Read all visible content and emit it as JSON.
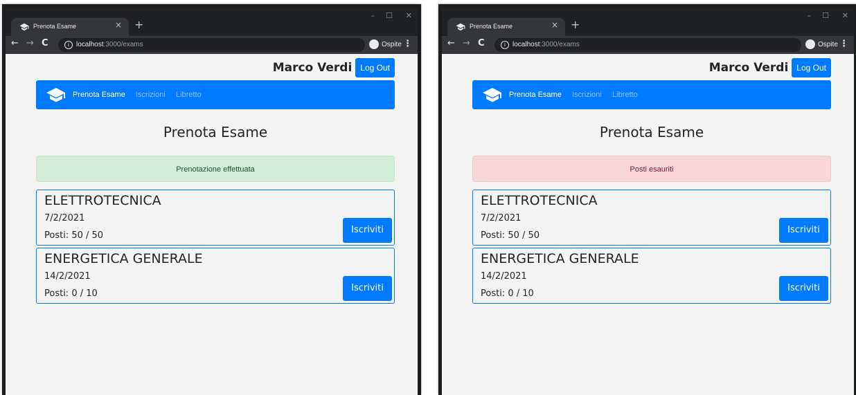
{
  "windows": [
    {
      "tab_title": "Prenota Esame",
      "tab_close": "×",
      "new_tab": "+",
      "controls": {
        "minimize": "–",
        "maximize": "☐",
        "close": "✕"
      },
      "url_host": "localhost",
      "url_rest": ":3000/exams",
      "profile_label": "Ospite",
      "username": "Marco Verdi",
      "logout_label": "Log Out",
      "nav": {
        "active": "Prenota Esame",
        "link2": "Iscrizioni",
        "link3": "Libretto"
      },
      "page_title": "Prenota Esame",
      "alert": {
        "type": "success",
        "text": "Prenotazione effettuata"
      },
      "exams": [
        {
          "name": "ELETTROTECNICA",
          "date": "7/2/2021",
          "seats": "Posti: 50 / 50",
          "button": "Iscriviti"
        },
        {
          "name": "ENERGETICA GENERALE",
          "date": "14/2/2021",
          "seats": "Posti: 0 / 10",
          "button": "Iscriviti"
        }
      ]
    },
    {
      "tab_title": "Prenota Esame",
      "tab_close": "×",
      "new_tab": "+",
      "controls": {
        "minimize": "–",
        "maximize": "☐",
        "close": "✕"
      },
      "url_host": "localhost",
      "url_rest": ":3000/exams",
      "profile_label": "Ospite",
      "username": "Marco Verdi",
      "logout_label": "Log Out",
      "nav": {
        "active": "Prenota Esame",
        "link2": "Iscrizioni",
        "link3": "Libretto"
      },
      "page_title": "Prenota Esame",
      "alert": {
        "type": "danger",
        "text": "Posti esauriti"
      },
      "exams": [
        {
          "name": "ELETTROTECNICA",
          "date": "7/2/2021",
          "seats": "Posti: 50 / 50",
          "button": "Iscriviti"
        },
        {
          "name": "ENERGETICA GENERALE",
          "date": "14/2/2021",
          "seats": "Posti: 0 / 10",
          "button": "Iscriviti"
        }
      ]
    }
  ],
  "colors": {
    "primary": "#007bff",
    "success_bg": "#d4edda",
    "danger_bg": "#f8d7da",
    "page_bg": "#f4f4f5"
  },
  "icons": [
    "graduation-cap-icon",
    "info-icon",
    "profile-icon",
    "back-arrow-icon",
    "forward-arrow-icon",
    "reload-icon",
    "menu-dots-icon"
  ]
}
